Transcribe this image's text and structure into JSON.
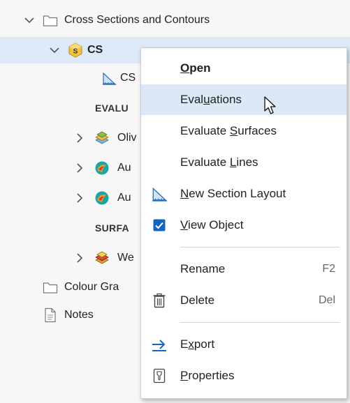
{
  "tree": {
    "root": {
      "label": "Cross Sections and Contours"
    },
    "cs": {
      "label": "CS"
    },
    "cs_child": {
      "label": "CS"
    },
    "evaluations_header": {
      "label": "EVALU"
    },
    "olivine": {
      "label": "Oliv"
    },
    "au1": {
      "label": "Au"
    },
    "au2": {
      "label": "Au"
    },
    "surfaces_header": {
      "label": "SURFA"
    },
    "we": {
      "label": "We"
    },
    "colour_gradients": {
      "label": "Colour Gra"
    },
    "notes": {
      "label": "Notes"
    }
  },
  "context_menu": {
    "open": {
      "pre": "",
      "u": "O",
      "post": "pen"
    },
    "evaluations": {
      "pre": "Eval",
      "u": "u",
      "post": "ations"
    },
    "evaluate_surfaces": {
      "pre": "Evaluate ",
      "u": "S",
      "post": "urfaces"
    },
    "evaluate_lines": {
      "pre": "Evaluate ",
      "u": "L",
      "post": "ines"
    },
    "new_section_layout": {
      "pre": "",
      "u": "N",
      "post": "ew Section Layout"
    },
    "view_object": {
      "pre": "",
      "u": "V",
      "post": "iew Object"
    },
    "rename": {
      "label": "Rename",
      "shortcut": "F2"
    },
    "delete": {
      "label": "Delete",
      "shortcut": "Del"
    },
    "export": {
      "pre": "E",
      "u": "x",
      "post": "port"
    },
    "properties": {
      "pre": "",
      "u": "P",
      "post": "roperties"
    }
  },
  "colors": {
    "selection": "#dde9f6",
    "hover": "#dbe8f6",
    "accent": "#1565c0"
  },
  "icons": [
    "chevron-down-icon",
    "folder-icon",
    "section-object-icon",
    "section-ruler-icon",
    "chevron-right-icon",
    "layers-icon",
    "surface-ball-icon",
    "note-icon",
    "checkbox-checked-icon",
    "trash-icon",
    "export-arrow-icon",
    "properties-icon",
    "mouse-cursor-icon"
  ]
}
